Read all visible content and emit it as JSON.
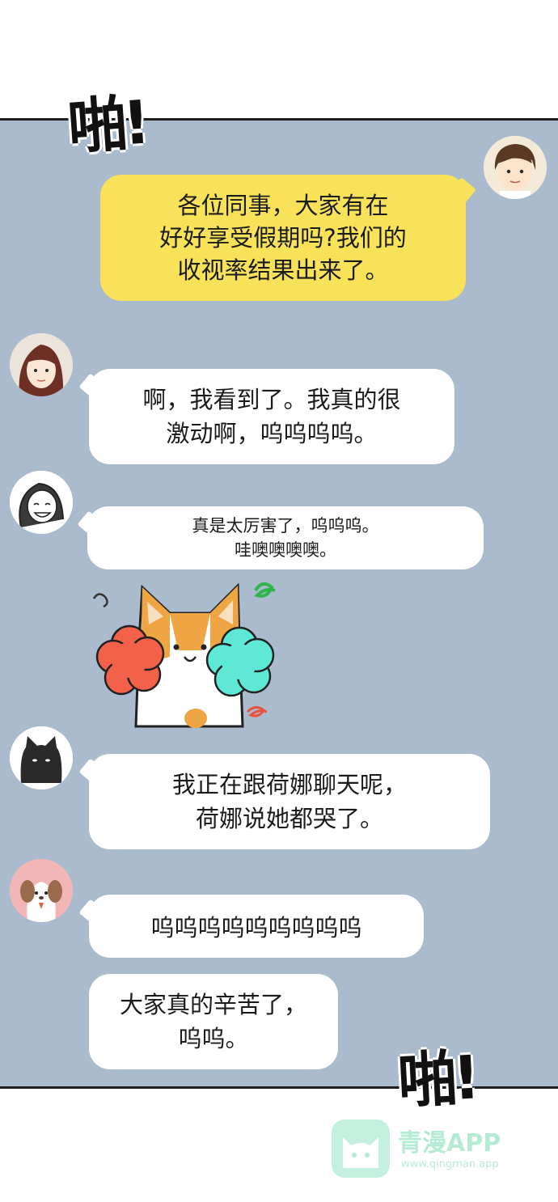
{
  "sfx": {
    "top": "啪!",
    "bottom": "啪!"
  },
  "messages": [
    {
      "lines": [
        "各位同事，大家有在",
        "好好享受假期吗?我们的",
        "收视率结果出来了。"
      ]
    },
    {
      "lines": [
        "啊，我看到了。我真的很",
        "激动啊，呜呜呜呜。"
      ]
    },
    {
      "lines": [
        "真是太厉害了，呜呜呜。",
        "哇噢噢噢噢。"
      ]
    },
    {
      "lines": [
        "我正在跟荷娜聊天呢，",
        "荷娜说她都哭了。"
      ]
    },
    {
      "lines": [
        "呜呜呜呜呜呜呜呜呜"
      ]
    },
    {
      "lines": [
        "大家真的辛苦了，",
        "呜呜。"
      ]
    }
  ],
  "watermark": {
    "title": "青漫APP",
    "url": "www.qingman.app"
  },
  "colors": {
    "panel": "#a9bbcd",
    "highlight_bubble": "#f7e25a",
    "bubble": "#ffffff"
  }
}
